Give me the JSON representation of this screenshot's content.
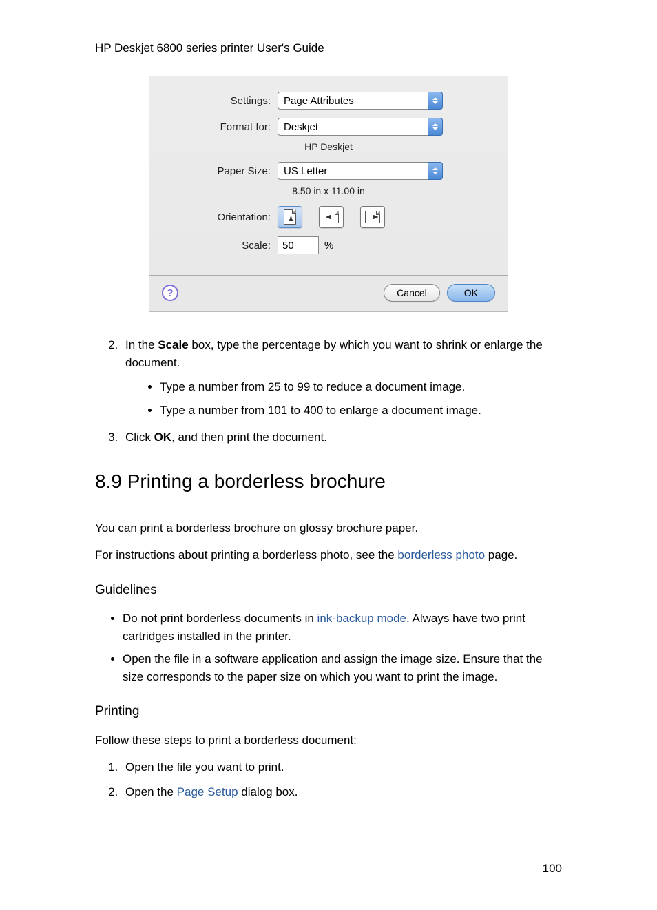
{
  "header": "HP Deskjet 6800 series printer User's Guide",
  "dialog": {
    "settings_label": "Settings:",
    "settings_value": "Page Attributes",
    "format_label": "Format for:",
    "format_value": "Deskjet",
    "format_sub": "HP Deskjet",
    "paper_label": "Paper Size:",
    "paper_value": "US Letter",
    "paper_sub": "8.50 in x 11.00 in",
    "orientation_label": "Orientation:",
    "scale_label": "Scale:",
    "scale_value": "50",
    "scale_suffix": "%",
    "help_label": "?",
    "cancel": "Cancel",
    "ok": "OK"
  },
  "step2": {
    "prefix": "In the ",
    "bold": "Scale",
    "suffix": " box, type the percentage by which you want to shrink or enlarge the document."
  },
  "step2_bullets": [
    "Type a number from 25 to 99 to reduce a document image.",
    "Type a number from 101 to 400 to enlarge a document image."
  ],
  "step3": {
    "prefix": "Click ",
    "bold": "OK",
    "suffix": ", and then print the document."
  },
  "section_title": "8.9  Printing a borderless brochure",
  "intro_p1": "You can print a borderless brochure on glossy brochure paper.",
  "intro_p2": {
    "prefix": "For instructions about printing a borderless photo, see the ",
    "link": "borderless photo",
    "suffix": " page."
  },
  "guidelines_title": "Guidelines",
  "guidelines": [
    {
      "prefix": "Do not print borderless documents in ",
      "link": "ink-backup mode",
      "suffix": ". Always have two print cartridges installed in the printer."
    },
    {
      "text": "Open the file in a software application and assign the image size. Ensure that the size corresponds to the paper size on which you want to print the image."
    }
  ],
  "printing_title": "Printing",
  "printing_intro": "Follow these steps to print a borderless document:",
  "printing_steps": [
    {
      "text": "Open the file you want to print."
    },
    {
      "prefix": "Open the ",
      "link": "Page Setup",
      "suffix": " dialog box."
    }
  ],
  "page_number": "100"
}
